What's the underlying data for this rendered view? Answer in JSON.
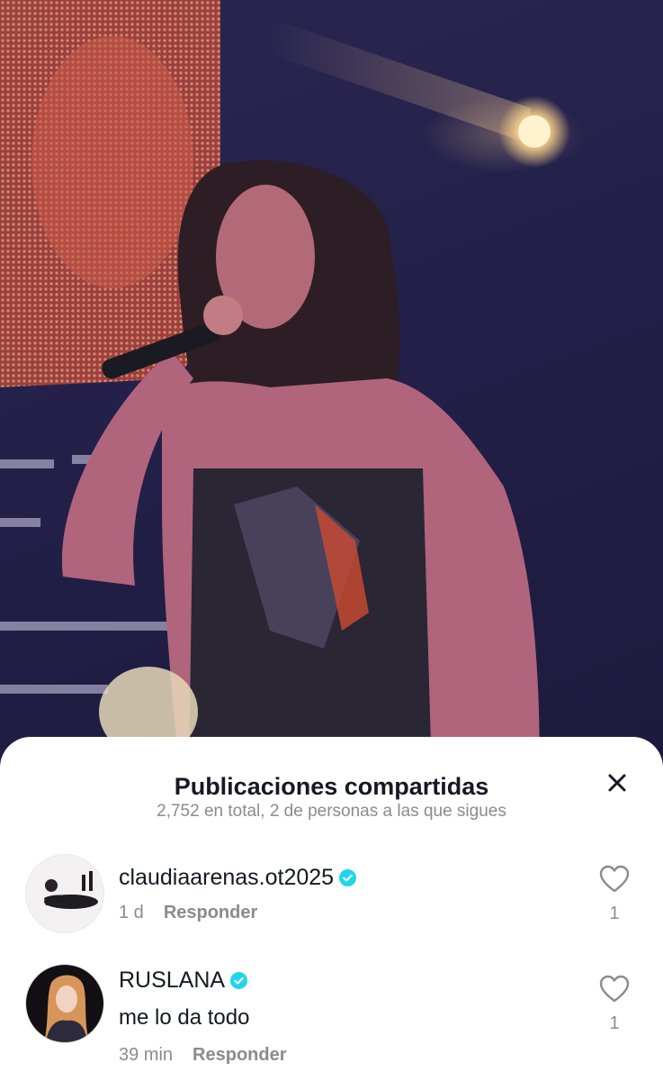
{
  "sheet": {
    "title": "Publicaciones compartidas",
    "subtitle": "2,752 en total, 2 de personas a las que sigues"
  },
  "comments": [
    {
      "username": "claudiaarenas.ot2025",
      "verified": true,
      "text": "",
      "time": "1 d",
      "reply_label": "Responder",
      "likes": "1"
    },
    {
      "username": "RUSLANA",
      "verified": true,
      "text": "me lo da todo",
      "time": "39 min",
      "reply_label": "Responder",
      "likes": "1"
    }
  ],
  "icons": {
    "close": "close-icon",
    "verified": "verified-badge-icon",
    "like": "heart-outline-icon"
  },
  "colors": {
    "verified_blue": "#20d5ec",
    "text_primary": "#161823",
    "text_secondary": "#8a8b91"
  }
}
